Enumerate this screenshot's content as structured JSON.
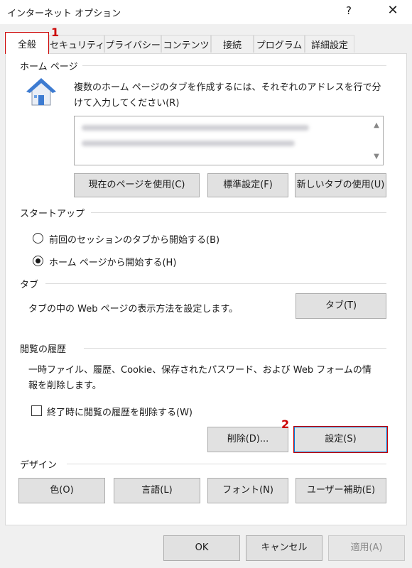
{
  "window": {
    "title": "インターネット オプション",
    "help_glyph": "?",
    "close_glyph": "✕"
  },
  "tabs": [
    {
      "label": "全般",
      "active": true
    },
    {
      "label": "セキュリティ"
    },
    {
      "label": "プライバシー"
    },
    {
      "label": "コンテンツ"
    },
    {
      "label": "接続"
    },
    {
      "label": "プログラム"
    },
    {
      "label": "詳細設定"
    }
  ],
  "callouts": {
    "one": "1",
    "two": "2"
  },
  "home_page": {
    "section_label": "ホーム ページ",
    "description": "複数のホーム ページのタブを作成するには、それぞれのアドレスを行で分けて入力してください(R)",
    "buttons": {
      "use_current": "現在のページを使用(C)",
      "use_default": "標準設定(F)",
      "use_new_tab": "新しいタブの使用(U)"
    }
  },
  "startup": {
    "section_label": "スタートアップ",
    "options": [
      {
        "label": "前回のセッションのタブから開始する(B)",
        "selected": false
      },
      {
        "label": "ホーム ページから開始する(H)",
        "selected": true
      }
    ]
  },
  "tabs_section": {
    "section_label": "タブ",
    "description": "タブの中の Web ページの表示方法を設定します。",
    "button": "タブ(T)"
  },
  "history": {
    "section_label": "閲覧の履歴",
    "description": "一時ファイル、履歴、Cookie、保存されたパスワード、および Web フォームの情報を削除します。",
    "checkbox_label": "終了時に閲覧の履歴を削除する(W)",
    "checkbox_checked": false,
    "delete_button": "削除(D)...",
    "settings_button": "設定(S)"
  },
  "design": {
    "section_label": "デザイン",
    "buttons": {
      "colors": "色(O)",
      "languages": "言語(L)",
      "fonts": "フォント(N)",
      "accessibility": "ユーザー補助(E)"
    }
  },
  "footer": {
    "ok": "OK",
    "cancel": "キャンセル",
    "apply": "適用(A)"
  },
  "colors": {
    "highlight_red": "#cc0000",
    "focus_blue": "#0078d7",
    "house_blue": "#3d7bd1"
  },
  "icons": {
    "home": "house-icon",
    "scroll_up": "chevron-up-icon",
    "scroll_down": "chevron-down-icon"
  }
}
